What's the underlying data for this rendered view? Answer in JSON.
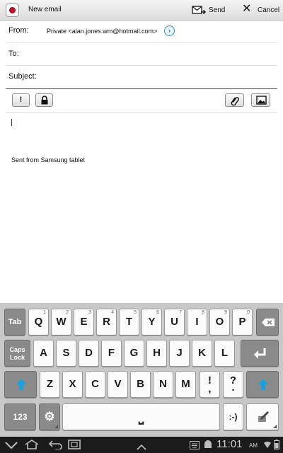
{
  "action_bar": {
    "title": "New email",
    "send_label": "Send",
    "cancel_label": "Cancel"
  },
  "fields": {
    "from_label": "From:",
    "from_value": "Private <alan.jones.wm@hotmail.com>",
    "to_label": "To:",
    "to_value": "",
    "subject_label": "Subject:",
    "subject_value": ""
  },
  "format_toolbar": {
    "priority_glyph": "!",
    "icons": [
      "priority-icon",
      "lock-icon",
      "attach-icon",
      "image-icon"
    ]
  },
  "body": {
    "signature": "Sent from Samsung tablet"
  },
  "keyboard": {
    "tab": "Tab",
    "caps_line1": "Caps",
    "caps_line2": "Lock",
    "row1": [
      "Q",
      "W",
      "E",
      "R",
      "T",
      "Y",
      "U",
      "I",
      "O",
      "P"
    ],
    "row2": [
      "A",
      "S",
      "D",
      "F",
      "G",
      "H",
      "J",
      "K",
      "L"
    ],
    "row3": [
      "Z",
      "X",
      "C",
      "V",
      "B",
      "N",
      "M"
    ],
    "punct1_main": "!",
    "punct1_sub": ",",
    "punct2_main": "?",
    "punct2_sub": ".",
    "numbers_label": "123",
    "space_glyph": "⎵",
    "emoticon_label": ":-)"
  },
  "status_bar": {
    "time": "11:01",
    "ampm": "AM"
  },
  "colors": {
    "accent_blue": "#1aa0e0",
    "app_icon_red": "#c8102e",
    "nav_background": "#1b1b1b"
  }
}
